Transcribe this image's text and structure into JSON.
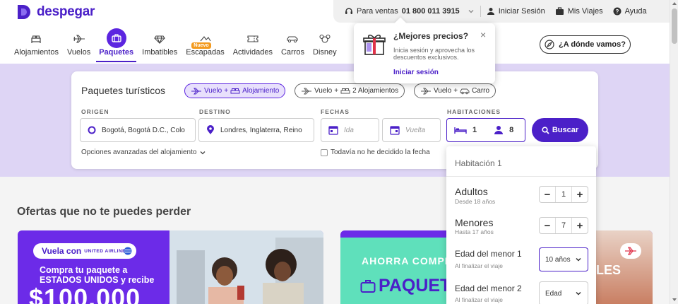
{
  "brand": {
    "name": "despegar",
    "color": "#4b20c8"
  },
  "topbar": {
    "sales_label": "Para ventas",
    "sales_phone": "01 800 011 3915",
    "login": "Iniciar Sesión",
    "trips": "Mis Viajes",
    "help": "Ayuda"
  },
  "nav": [
    {
      "label": "Alojamientos",
      "icon": "hotel-icon"
    },
    {
      "label": "Vuelos",
      "icon": "plane-icon"
    },
    {
      "label": "Paquetes",
      "icon": "suitcase-icon",
      "active": true
    },
    {
      "label": "Imbatibles",
      "icon": "diamond-icon"
    },
    {
      "label": "Escapadas",
      "icon": "escape-icon",
      "badge": "Nuevo"
    },
    {
      "label": "Actividades",
      "icon": "ticket-icon"
    },
    {
      "label": "Carros",
      "icon": "car-icon"
    },
    {
      "label": "Disney",
      "icon": "disney-icon"
    }
  ],
  "where_button": "¿A dónde vamos?",
  "search": {
    "title": "Paquetes turísticos",
    "options": [
      {
        "prefix": "Vuelo",
        "suffix": "Alojamiento",
        "selected": true
      },
      {
        "prefix": "Vuelo",
        "suffix": "2 Alojamientos",
        "selected": false
      },
      {
        "prefix": "Vuelo",
        "suffix": "Carro",
        "selected": false
      }
    ],
    "labels": {
      "origin": "ORIGEN",
      "destination": "DESTINO",
      "dates": "FECHAS",
      "rooms": "HABITACIONES"
    },
    "origin_value": "Bogotá, Bogotá D.C., Colo",
    "destination_value": "Londres, Inglaterra, Reino",
    "date_from_placeholder": "Ida",
    "date_to_placeholder": "Vuelta",
    "rooms_count": "1",
    "guests_count": "8",
    "search_button": "Buscar",
    "advanced": "Opciones avanzadas del alojamiento",
    "no_date": "Todavía no he decidido la fecha"
  },
  "offers_title": "Ofertas que no te puedes perder",
  "banner1": {
    "airline_prefix": "Vuela con",
    "airline": "UNITED AIRLINES",
    "line1": "Compra tu paquete a",
    "line2": "ESTADOS UNIDOS y recibe",
    "price": "$100.000"
  },
  "banner2": {
    "line1": "AHORRA COMPRA",
    "line2": "PAQUET",
    "partial_right": "LES"
  },
  "promo_popup": {
    "title": "¿Mejores precios?",
    "desc": "Inicia sesión y aprovecha los descuentos exclusivos.",
    "link": "Iniciar sesión",
    "close": "×"
  },
  "rooms_dropdown": {
    "room_title": "Habitación 1",
    "adults_label": "Adultos",
    "adults_sub": "Desde 18 años",
    "adults_value": "1",
    "minors_label": "Menores",
    "minors_sub": "Hasta 17 años",
    "minors_value": "7",
    "minor1_label": "Edad del menor 1",
    "minor1_sub": "Al finalizar el viaje",
    "minor1_value": "10 años",
    "minor2_label": "Edad del menor 2",
    "minor2_sub": "Al finalizar el viaje",
    "minor2_value": "Edad",
    "minus": "−",
    "plus": "+"
  }
}
